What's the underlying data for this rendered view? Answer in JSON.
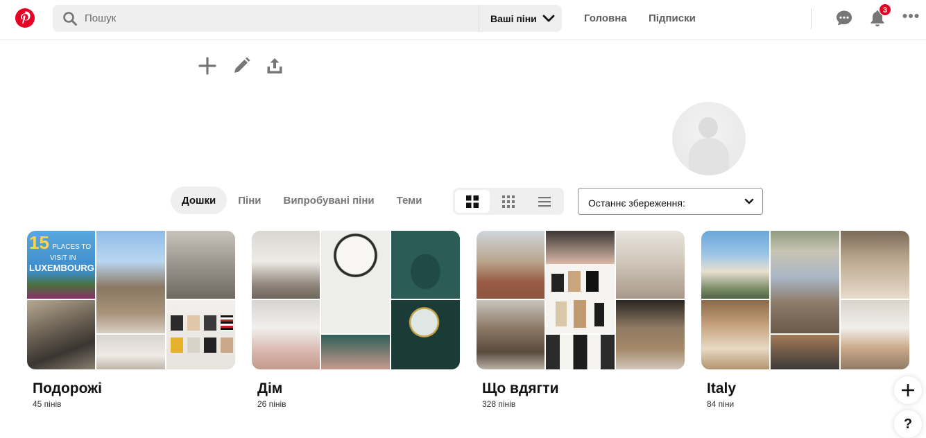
{
  "header": {
    "logo": "pinterest-logo",
    "search_placeholder": "Пошук",
    "search_scope": "Ваші піни",
    "nav_home": "Головна",
    "nav_following": "Підписки",
    "notification_count": "3",
    "brand_color": "#e60023"
  },
  "toolbar": {
    "icons": [
      "plus-icon",
      "pencil-icon",
      "share-icon"
    ]
  },
  "tabs": [
    {
      "label": "Дошки",
      "active": true
    },
    {
      "label": "Піни",
      "active": false
    },
    {
      "label": "Випробувані піни",
      "active": false
    },
    {
      "label": "Теми",
      "active": false
    }
  ],
  "view_modes": [
    "large-grid-icon",
    "small-grid-icon",
    "list-icon"
  ],
  "sort": {
    "selected": "Останнє збереження:"
  },
  "boards": [
    {
      "title": "Подорожі",
      "count": "45 пінів",
      "cover_text": {
        "number": "15",
        "line1": "PLACES TO",
        "line2": "VISIT IN",
        "line3": "LUXEMBOURG"
      }
    },
    {
      "title": "Дім",
      "count": "26 пінів"
    },
    {
      "title": "Що вдягти",
      "count": "328 пінів"
    },
    {
      "title": "Italy",
      "count": "84 піни"
    }
  ],
  "fab": {
    "help": "?"
  }
}
